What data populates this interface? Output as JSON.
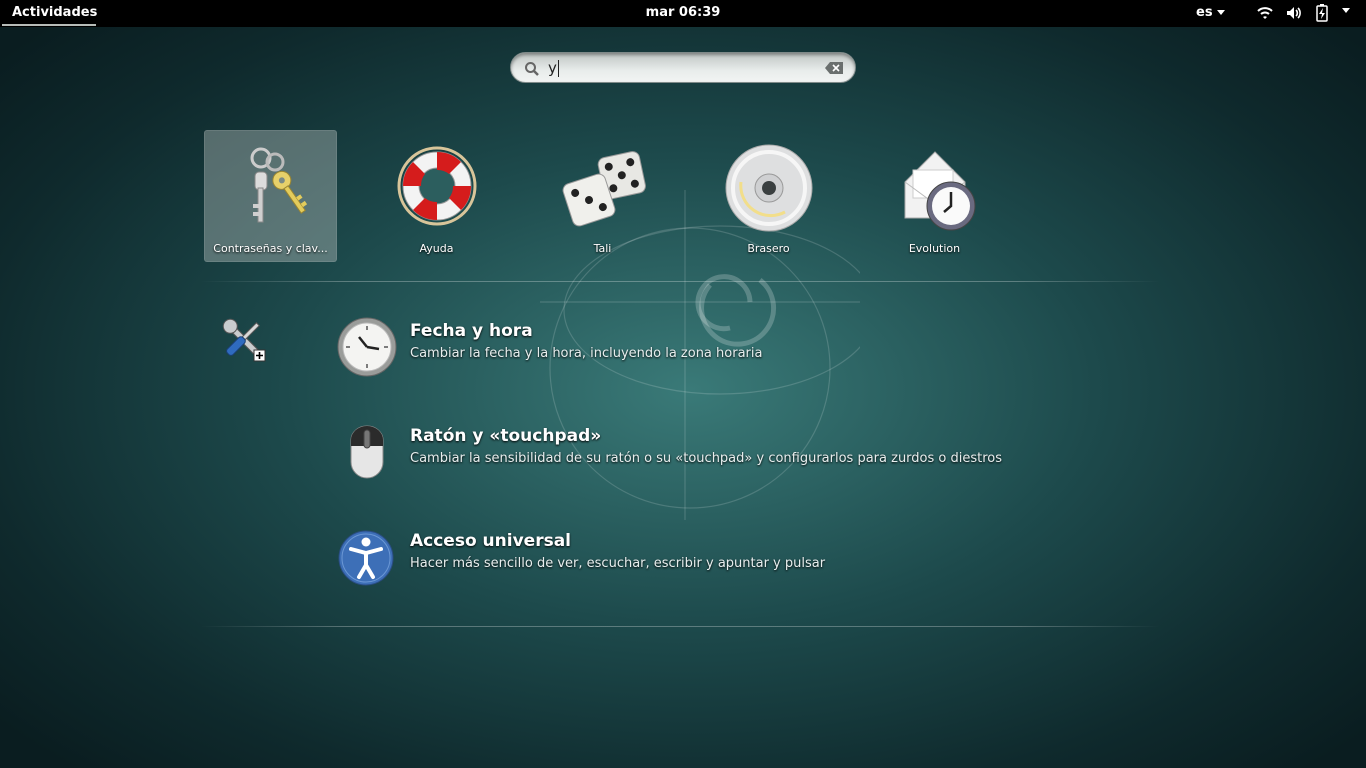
{
  "topbar": {
    "activities": "Actividades",
    "clock": "mar 06:39",
    "language": "es",
    "icons": [
      "wifi-icon",
      "volume-icon",
      "battery-icon",
      "system-menu-icon"
    ]
  },
  "search": {
    "value": "y",
    "icons": [
      "search-icon",
      "clear-icon"
    ]
  },
  "apps": [
    {
      "label": "Contraseñas y clav...",
      "icon": "keys-icon",
      "selected": true
    },
    {
      "label": "Ayuda",
      "icon": "lifebuoy-icon"
    },
    {
      "label": "Tali",
      "icon": "dice-icon"
    },
    {
      "label": "Brasero",
      "icon": "disc-icon"
    },
    {
      "label": "Evolution",
      "icon": "mail-clock-icon"
    }
  ],
  "settings": {
    "provider_icon": "settings-tools-icon",
    "results": [
      {
        "title": "Fecha y hora",
        "description": "Cambiar la fecha y la hora, incluyendo la zona horaria",
        "icon": "clock-icon"
      },
      {
        "title": "Ratón y «touchpad»",
        "description": "Cambiar la sensibilidad de su ratón o su «touchpad» y configurarlos para zurdos o diestros",
        "icon": "mouse-icon"
      },
      {
        "title": "Acceso universal",
        "description": "Hacer más sencillo de ver, escuchar, escribir y apuntar y pulsar",
        "icon": "accessibility-icon"
      }
    ]
  },
  "colors": {
    "topbar_bg": "#000000",
    "background_center": "#3a7a78",
    "background_edge": "#0a1d20",
    "selection": "#7d8a89"
  }
}
